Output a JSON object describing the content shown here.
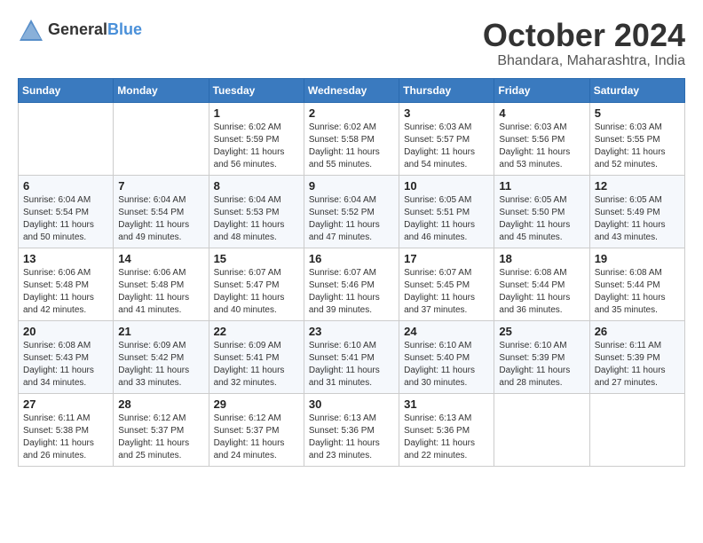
{
  "header": {
    "logo_general": "General",
    "logo_blue": "Blue",
    "title": "October 2024",
    "location": "Bhandara, Maharashtra, India"
  },
  "calendar": {
    "days_of_week": [
      "Sunday",
      "Monday",
      "Tuesday",
      "Wednesday",
      "Thursday",
      "Friday",
      "Saturday"
    ],
    "weeks": [
      [
        {
          "day": "",
          "info": ""
        },
        {
          "day": "",
          "info": ""
        },
        {
          "day": "1",
          "info": "Sunrise: 6:02 AM\nSunset: 5:59 PM\nDaylight: 11 hours and 56 minutes."
        },
        {
          "day": "2",
          "info": "Sunrise: 6:02 AM\nSunset: 5:58 PM\nDaylight: 11 hours and 55 minutes."
        },
        {
          "day": "3",
          "info": "Sunrise: 6:03 AM\nSunset: 5:57 PM\nDaylight: 11 hours and 54 minutes."
        },
        {
          "day": "4",
          "info": "Sunrise: 6:03 AM\nSunset: 5:56 PM\nDaylight: 11 hours and 53 minutes."
        },
        {
          "day": "5",
          "info": "Sunrise: 6:03 AM\nSunset: 5:55 PM\nDaylight: 11 hours and 52 minutes."
        }
      ],
      [
        {
          "day": "6",
          "info": "Sunrise: 6:04 AM\nSunset: 5:54 PM\nDaylight: 11 hours and 50 minutes."
        },
        {
          "day": "7",
          "info": "Sunrise: 6:04 AM\nSunset: 5:54 PM\nDaylight: 11 hours and 49 minutes."
        },
        {
          "day": "8",
          "info": "Sunrise: 6:04 AM\nSunset: 5:53 PM\nDaylight: 11 hours and 48 minutes."
        },
        {
          "day": "9",
          "info": "Sunrise: 6:04 AM\nSunset: 5:52 PM\nDaylight: 11 hours and 47 minutes."
        },
        {
          "day": "10",
          "info": "Sunrise: 6:05 AM\nSunset: 5:51 PM\nDaylight: 11 hours and 46 minutes."
        },
        {
          "day": "11",
          "info": "Sunrise: 6:05 AM\nSunset: 5:50 PM\nDaylight: 11 hours and 45 minutes."
        },
        {
          "day": "12",
          "info": "Sunrise: 6:05 AM\nSunset: 5:49 PM\nDaylight: 11 hours and 43 minutes."
        }
      ],
      [
        {
          "day": "13",
          "info": "Sunrise: 6:06 AM\nSunset: 5:48 PM\nDaylight: 11 hours and 42 minutes."
        },
        {
          "day": "14",
          "info": "Sunrise: 6:06 AM\nSunset: 5:48 PM\nDaylight: 11 hours and 41 minutes."
        },
        {
          "day": "15",
          "info": "Sunrise: 6:07 AM\nSunset: 5:47 PM\nDaylight: 11 hours and 40 minutes."
        },
        {
          "day": "16",
          "info": "Sunrise: 6:07 AM\nSunset: 5:46 PM\nDaylight: 11 hours and 39 minutes."
        },
        {
          "day": "17",
          "info": "Sunrise: 6:07 AM\nSunset: 5:45 PM\nDaylight: 11 hours and 37 minutes."
        },
        {
          "day": "18",
          "info": "Sunrise: 6:08 AM\nSunset: 5:44 PM\nDaylight: 11 hours and 36 minutes."
        },
        {
          "day": "19",
          "info": "Sunrise: 6:08 AM\nSunset: 5:44 PM\nDaylight: 11 hours and 35 minutes."
        }
      ],
      [
        {
          "day": "20",
          "info": "Sunrise: 6:08 AM\nSunset: 5:43 PM\nDaylight: 11 hours and 34 minutes."
        },
        {
          "day": "21",
          "info": "Sunrise: 6:09 AM\nSunset: 5:42 PM\nDaylight: 11 hours and 33 minutes."
        },
        {
          "day": "22",
          "info": "Sunrise: 6:09 AM\nSunset: 5:41 PM\nDaylight: 11 hours and 32 minutes."
        },
        {
          "day": "23",
          "info": "Sunrise: 6:10 AM\nSunset: 5:41 PM\nDaylight: 11 hours and 31 minutes."
        },
        {
          "day": "24",
          "info": "Sunrise: 6:10 AM\nSunset: 5:40 PM\nDaylight: 11 hours and 30 minutes."
        },
        {
          "day": "25",
          "info": "Sunrise: 6:10 AM\nSunset: 5:39 PM\nDaylight: 11 hours and 28 minutes."
        },
        {
          "day": "26",
          "info": "Sunrise: 6:11 AM\nSunset: 5:39 PM\nDaylight: 11 hours and 27 minutes."
        }
      ],
      [
        {
          "day": "27",
          "info": "Sunrise: 6:11 AM\nSunset: 5:38 PM\nDaylight: 11 hours and 26 minutes."
        },
        {
          "day": "28",
          "info": "Sunrise: 6:12 AM\nSunset: 5:37 PM\nDaylight: 11 hours and 25 minutes."
        },
        {
          "day": "29",
          "info": "Sunrise: 6:12 AM\nSunset: 5:37 PM\nDaylight: 11 hours and 24 minutes."
        },
        {
          "day": "30",
          "info": "Sunrise: 6:13 AM\nSunset: 5:36 PM\nDaylight: 11 hours and 23 minutes."
        },
        {
          "day": "31",
          "info": "Sunrise: 6:13 AM\nSunset: 5:36 PM\nDaylight: 11 hours and 22 minutes."
        },
        {
          "day": "",
          "info": ""
        },
        {
          "day": "",
          "info": ""
        }
      ]
    ]
  }
}
